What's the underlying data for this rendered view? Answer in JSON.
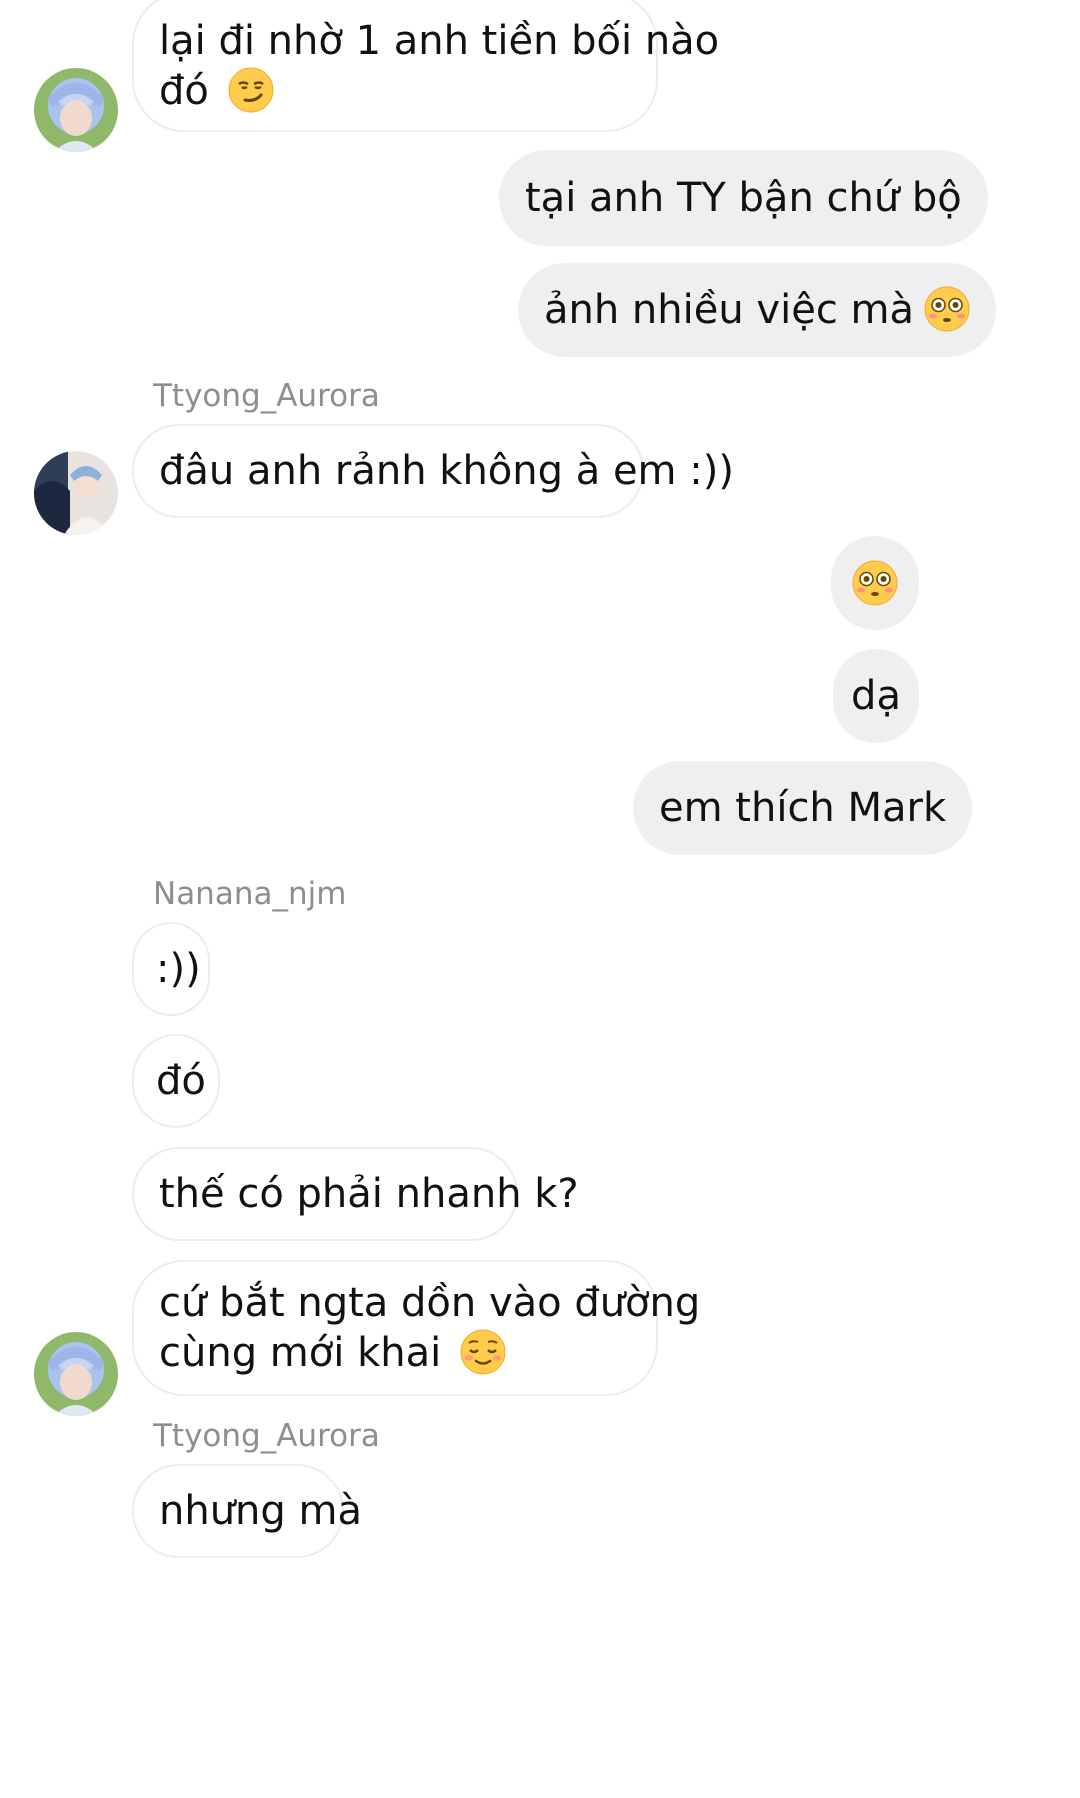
{
  "conversation": {
    "messages": [
      {
        "id": "m1",
        "line1": "lại đi nhờ 1 anh tiền bối nào",
        "line2": "đó",
        "emoji": "smirk-emoji"
      },
      {
        "id": "m2",
        "text": "tại anh TY bận chứ bộ"
      },
      {
        "id": "m3",
        "text": "ảnh nhiều việc mà",
        "emoji": "flushed-emoji"
      },
      {
        "id": "m4",
        "sender": "Ttyong_Aurora",
        "text": "đâu anh rảnh không à em :))"
      },
      {
        "id": "m5",
        "text": "",
        "emoji": "flushed-emoji"
      },
      {
        "id": "m6",
        "text": "dạ"
      },
      {
        "id": "m7",
        "text": "em thích Mark"
      },
      {
        "id": "m8",
        "sender": "Nanana_njm",
        "text": ":))"
      },
      {
        "id": "m9",
        "text": "đó"
      },
      {
        "id": "m10",
        "text": "thế có phải nhanh k?"
      },
      {
        "id": "m11",
        "line1": "cứ bắt ngta dồn vào đường",
        "line2": "cùng mới khai",
        "emoji": "relieved-emoji"
      },
      {
        "id": "m12",
        "sender": "Ttyong_Aurora",
        "text": "nhưng mà"
      }
    ]
  },
  "colors": {
    "outgoing_bubble": "#efefef",
    "incoming_border": "#ececec",
    "sender_name": "#8e8e8e",
    "text": "#111111",
    "emoji_face": "#ffcc4d"
  }
}
